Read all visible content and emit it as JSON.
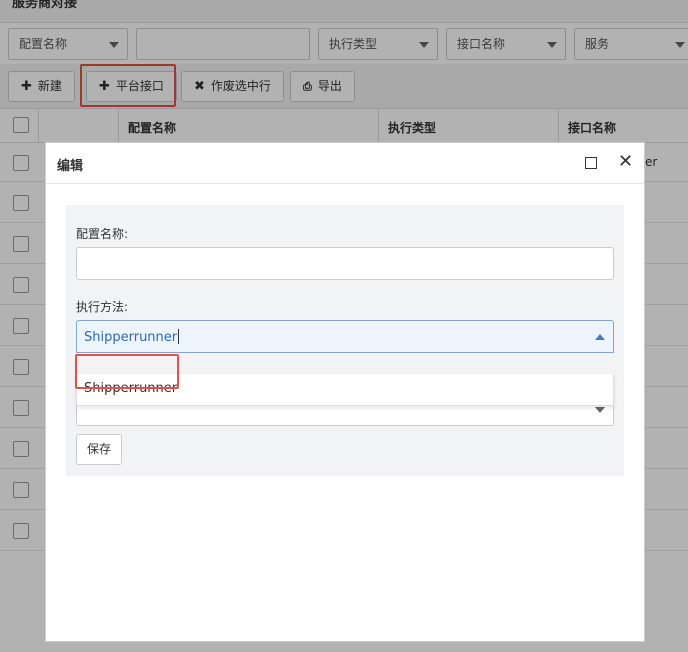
{
  "page": {
    "title": "服务商对接"
  },
  "filters": [
    {
      "label": "配置名称",
      "has_caret": true
    },
    {
      "label": "",
      "has_caret": false
    },
    {
      "label": "执行类型",
      "has_caret": true
    },
    {
      "label": "接口名称",
      "has_caret": true
    },
    {
      "label": "服务",
      "has_caret": true
    }
  ],
  "toolbar": {
    "new_label": "新建",
    "platform_label": "平台接口",
    "void_label": "作废选中行",
    "export_label": "导出"
  },
  "grid": {
    "columns": [
      "配置名称",
      "执行类型",
      "接口名称"
    ],
    "partial_cell": "er"
  },
  "modal": {
    "title": "编辑",
    "config_name_label": "配置名称:",
    "config_name_value": "",
    "method_label": "执行方法:",
    "method_value": "Shipperrunner",
    "dropdown_options": [
      "Shipperrunner"
    ],
    "third_select_value": "",
    "save_label": "保存"
  },
  "colors": {
    "highlight": "#e0524a",
    "select_text": "#2a6bb0"
  }
}
